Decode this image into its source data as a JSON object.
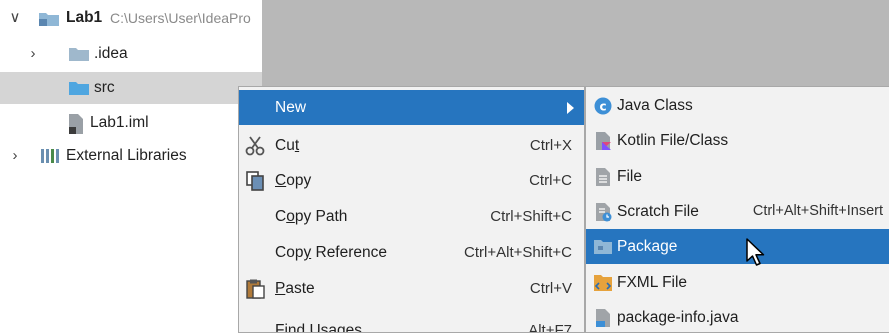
{
  "tree": {
    "root": {
      "name": "Lab1",
      "path": "C:\\Users\\User\\IdeaPro"
    },
    "idea": ".idea",
    "src": "src",
    "iml": "Lab1.iml",
    "external": "External Libraries"
  },
  "context_menu": {
    "items": [
      {
        "label": "New",
        "shortcut": ""
      },
      {
        "label_pre": "Cu",
        "label_mnemonic": "t",
        "label_post": "",
        "shortcut": "Ctrl+X"
      },
      {
        "label_pre": "",
        "label_mnemonic": "C",
        "label_post": "opy",
        "shortcut": "Ctrl+C"
      },
      {
        "label_pre": "C",
        "label_mnemonic": "o",
        "label_post": "py Path",
        "shortcut": "Ctrl+Shift+C"
      },
      {
        "label_pre": "Cop",
        "label_mnemonic": "y",
        "label_post": " Reference",
        "shortcut": "Ctrl+Alt+Shift+C"
      },
      {
        "label_pre": "",
        "label_mnemonic": "P",
        "label_post": "aste",
        "shortcut": "Ctrl+V"
      },
      {
        "label_pre": "Find ",
        "label_mnemonic": "U",
        "label_post": "sages",
        "shortcut": "Alt+F7"
      }
    ]
  },
  "submenu": {
    "items": [
      {
        "label": "Java Class",
        "shortcut": "",
        "icon": "java-class-icon"
      },
      {
        "label": "Kotlin File/Class",
        "shortcut": "",
        "icon": "kotlin-file-icon"
      },
      {
        "label": "File",
        "shortcut": "",
        "icon": "file-icon"
      },
      {
        "label": "Scratch File",
        "shortcut": "Ctrl+Alt+Shift+Insert",
        "icon": "scratch-file-icon"
      },
      {
        "label": "Package",
        "shortcut": "",
        "icon": "package-icon"
      },
      {
        "label": "FXML File",
        "shortcut": "",
        "icon": "fxml-file-icon"
      },
      {
        "label": "package-info.java",
        "shortcut": "",
        "icon": "java-file-icon"
      }
    ]
  },
  "colors": {
    "selection": "#2675bf",
    "tree_selected": "#d5d5d5",
    "menu_bg": "#f2f2f2",
    "folder": "#8fb7d6",
    "source_folder": "#4fa6e0"
  }
}
